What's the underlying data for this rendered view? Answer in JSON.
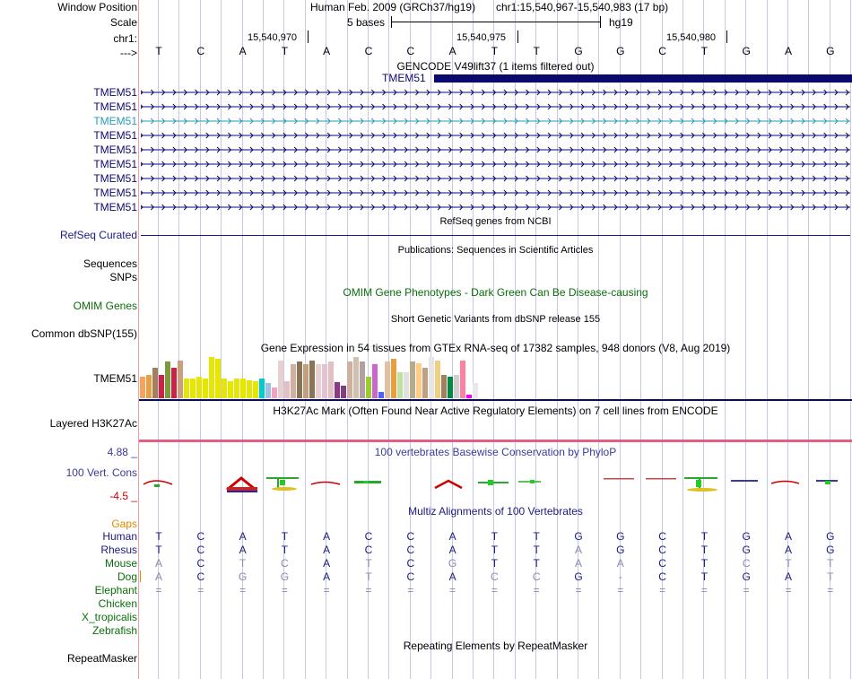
{
  "header": {
    "window_position_label": "Window Position",
    "scale_label": "Scale",
    "chrom_label": "chr1:",
    "strand_label": "--->",
    "assembly": "Human Feb. 2009 (GRCh37/hg19)",
    "position": "chr1:15,540,967-15,540,983 (17 bp)",
    "scale_text": "5 bases",
    "db_label": "hg19",
    "ticks": [
      "15,540,970",
      "15,540,975",
      "15,540,980"
    ],
    "bases": [
      "T",
      "C",
      "A",
      "T",
      "A",
      "C",
      "C",
      "A",
      "T",
      "T",
      "G",
      "G",
      "C",
      "T",
      "G",
      "A",
      "G"
    ]
  },
  "gencode": {
    "title": "GENCODE V49lift37 (1 items filtered out)",
    "top_gene_label": "TMEM51",
    "transcript_labels": [
      "TMEM51",
      "TMEM51",
      "TMEM51",
      "TMEM51",
      "TMEM51",
      "TMEM51",
      "TMEM51",
      "TMEM51",
      "TMEM51"
    ],
    "colors": {
      "dark": "#0a0a6e",
      "highlight": "#2a9ab8"
    }
  },
  "refseq": {
    "title": "RefSeq genes from NCBI",
    "label": "RefSeq Curated",
    "color": "#1a1a80"
  },
  "publications": {
    "title": "Publications: Sequences in Scientific Articles",
    "labels": [
      "Sequences",
      "SNPs"
    ]
  },
  "omim": {
    "title": "OMIM Gene Phenotypes - Dark Green Can Be Disease-causing",
    "label": "OMIM Genes",
    "color": "#0b6e0b"
  },
  "dbsnp": {
    "title": "Short Genetic Variants from dbSNP release 155",
    "label": "Common dbSNP(155)"
  },
  "gtex": {
    "title": "Gene Expression in 54 tissues from GTEx RNA-seq of 17382 samples, 948 donors (V8, Aug 2019)",
    "label": "TMEM51",
    "levels": [
      0.5,
      0.55,
      0.7,
      0.55,
      0.85,
      0.7,
      0.88,
      0.45,
      0.45,
      0.5,
      0.45,
      0.95,
      0.92,
      0.45,
      0.4,
      0.45,
      0.45,
      0.42,
      0.4,
      0.45,
      0.35,
      0.25,
      0.88,
      0.4,
      0.8,
      0.85,
      0.8,
      0.88,
      0.8,
      0.8,
      0.85,
      0.38,
      0.3,
      0.85,
      0.95,
      0.85,
      0.5,
      0.8,
      0.15,
      0.85,
      0.92,
      0.6,
      0.6,
      0.85,
      0.82,
      0.7,
      0.95,
      0.88,
      0.55,
      0.5,
      0.55,
      0.88,
      0.08,
      0.35
    ],
    "colors": [
      "#f4a460",
      "#e8a040",
      "#a08060",
      "#cc2244",
      "#7a9a3c",
      "#cc2244",
      "#c8a080",
      "#e6e600",
      "#e6e600",
      "#e6e600",
      "#e6e600",
      "#e6e600",
      "#e6e600",
      "#e6e600",
      "#e6e600",
      "#e6e600",
      "#e6e600",
      "#e6e600",
      "#e6e600",
      "#00cccc",
      "#a0c0e0",
      "#f4a0c0",
      "#e6d0d0",
      "#e6c0c0",
      "#d0b0a0",
      "#8b7355",
      "#c0a080",
      "#8b7355",
      "#e6d0d0",
      "#e6c0d0",
      "#e0c0c0",
      "#8b3a8b",
      "#804080",
      "#d0b0a0",
      "#d0c0b0",
      "#b0a0a0",
      "#9acd32",
      "#cc66cc",
      "#5060ff",
      "#e0c0a0",
      "#e6a040",
      "#c0e0a0",
      "#e0e0e0",
      "#bbaa88",
      "#ffcc88",
      "#c0a080",
      "#e6e6e6",
      "#f0d080",
      "#a08060",
      "#008b45",
      "#d0d0d0",
      "#ff80a0",
      "#ee00ee",
      "#e8e8e8"
    ]
  },
  "h3k27ac": {
    "title": "H3K27Ac Mark (Often Found Near Active Regulatory Elements) on 7 cell lines from ENCODE",
    "label": "Layered H3K27Ac"
  },
  "conservation": {
    "title": "100 vertebrates Basewise Conservation by PhyloP",
    "label": "100 Vert. Cons",
    "ymax": "4.88 _",
    "ymin": "-4.5 _",
    "colors": {
      "label": "#3a3a9a",
      "pos": "#cc0000",
      "neg": "#2222aa"
    }
  },
  "multiz": {
    "title": "Multiz Alignments of 100 Vertebrates",
    "gaps_label": "Gaps",
    "species": [
      "Human",
      "Rhesus",
      "Mouse",
      "Dog",
      "Elephant",
      "Chicken",
      "X_tropicalis",
      "Zebrafish"
    ],
    "rows": [
      [
        "T",
        "C",
        "A",
        "T",
        "A",
        "C",
        "C",
        "A",
        "T",
        "T",
        "G",
        "G",
        "C",
        "T",
        "G",
        "A",
        "G"
      ],
      [
        "T",
        "C",
        "A",
        "T",
        "A",
        "C",
        "C",
        "A",
        "T",
        "T",
        "A",
        "G",
        "C",
        "T",
        "G",
        "A",
        "G"
      ],
      [
        "A",
        "C",
        "T",
        "C",
        "A",
        "T",
        "C",
        "G",
        "T",
        "T",
        "A",
        "A",
        "C",
        "T",
        "C",
        "T",
        "T"
      ],
      [
        "A",
        "C",
        "G",
        "G",
        "A",
        "T",
        "C",
        "A",
        "C",
        "C",
        "G",
        "-",
        "C",
        "T",
        "G",
        "A",
        "T"
      ],
      [
        "=",
        "=",
        "=",
        "=",
        "=",
        "=",
        "=",
        "=",
        "=",
        "=",
        "=",
        "=",
        "=",
        "=",
        "=",
        "=",
        "="
      ]
    ],
    "colors": {
      "human": "#1a1a80",
      "mismatch": "#8a8ab0",
      "species": "#0b6e0b",
      "gaps": "#e08a00"
    }
  },
  "repeatmasker": {
    "title": "Repeating Elements by RepeatMasker",
    "label": "RepeatMasker"
  }
}
